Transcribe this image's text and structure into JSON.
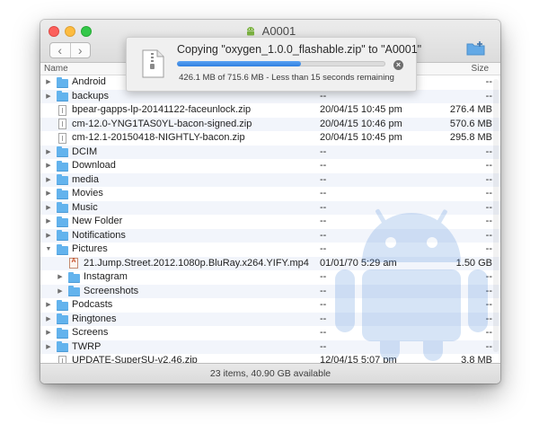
{
  "window": {
    "title": "A0001",
    "status": "23 items, 40.90 GB available"
  },
  "columns": {
    "name": "Name",
    "size": "Size"
  },
  "copy": {
    "title": "Copying \"oxygen_1.0.0_flashable.zip\" to \"A0001\"",
    "detail": "426.1 MB of 715.6 MB - Less than 15 seconds remaining",
    "progress": 0.595
  },
  "rows": [
    {
      "name": "Android",
      "date": "--",
      "size": "--",
      "type": "folder",
      "level": 0,
      "disclosure": "collapsed"
    },
    {
      "name": "backups",
      "date": "--",
      "size": "--",
      "type": "folder",
      "level": 0,
      "disclosure": "collapsed"
    },
    {
      "name": "bpear-gapps-lp-20141122-faceunlock.zip",
      "date": "20/04/15 10:45 pm",
      "size": "276.4 MB",
      "type": "file",
      "level": 0,
      "disclosure": "none"
    },
    {
      "name": "cm-12.0-YNG1TAS0YL-bacon-signed.zip",
      "date": "20/04/15 10:46 pm",
      "size": "570.6 MB",
      "type": "file",
      "level": 0,
      "disclosure": "none"
    },
    {
      "name": "cm-12.1-20150418-NIGHTLY-bacon.zip",
      "date": "20/04/15 10:45 pm",
      "size": "295.8 MB",
      "type": "file",
      "level": 0,
      "disclosure": "none"
    },
    {
      "name": "DCIM",
      "date": "--",
      "size": "--",
      "type": "folder",
      "level": 0,
      "disclosure": "collapsed"
    },
    {
      "name": "Download",
      "date": "--",
      "size": "--",
      "type": "folder",
      "level": 0,
      "disclosure": "collapsed"
    },
    {
      "name": "media",
      "date": "--",
      "size": "--",
      "type": "folder",
      "level": 0,
      "disclosure": "collapsed"
    },
    {
      "name": "Movies",
      "date": "--",
      "size": "--",
      "type": "folder",
      "level": 0,
      "disclosure": "collapsed"
    },
    {
      "name": "Music",
      "date": "--",
      "size": "--",
      "type": "folder",
      "level": 0,
      "disclosure": "collapsed"
    },
    {
      "name": "New Folder",
      "date": "--",
      "size": "--",
      "type": "folder",
      "level": 0,
      "disclosure": "collapsed"
    },
    {
      "name": "Notifications",
      "date": "--",
      "size": "--",
      "type": "folder",
      "level": 0,
      "disclosure": "collapsed"
    },
    {
      "name": "Pictures",
      "date": "--",
      "size": "--",
      "type": "folder",
      "level": 0,
      "disclosure": "expanded"
    },
    {
      "name": "21.Jump.Street.2012.1080p.BluRay.x264.YIFY.mp4",
      "date": "01/01/70 5:29 am",
      "size": "1.50 GB",
      "type": "media",
      "level": 1,
      "disclosure": "none"
    },
    {
      "name": "Instagram",
      "date": "--",
      "size": "--",
      "type": "folder",
      "level": 1,
      "disclosure": "collapsed"
    },
    {
      "name": "Screenshots",
      "date": "--",
      "size": "--",
      "type": "folder",
      "level": 1,
      "disclosure": "collapsed"
    },
    {
      "name": "Podcasts",
      "date": "--",
      "size": "--",
      "type": "folder",
      "level": 0,
      "disclosure": "collapsed"
    },
    {
      "name": "Ringtones",
      "date": "--",
      "size": "--",
      "type": "folder",
      "level": 0,
      "disclosure": "collapsed"
    },
    {
      "name": "Screens",
      "date": "--",
      "size": "--",
      "type": "folder",
      "level": 0,
      "disclosure": "collapsed"
    },
    {
      "name": "TWRP",
      "date": "--",
      "size": "--",
      "type": "folder",
      "level": 0,
      "disclosure": "collapsed"
    },
    {
      "name": "UPDATE-SuperSU-v2.46.zip",
      "date": "12/04/15 5:07 pm",
      "size": "3.8 MB",
      "type": "file",
      "level": 0,
      "disclosure": "none"
    }
  ]
}
